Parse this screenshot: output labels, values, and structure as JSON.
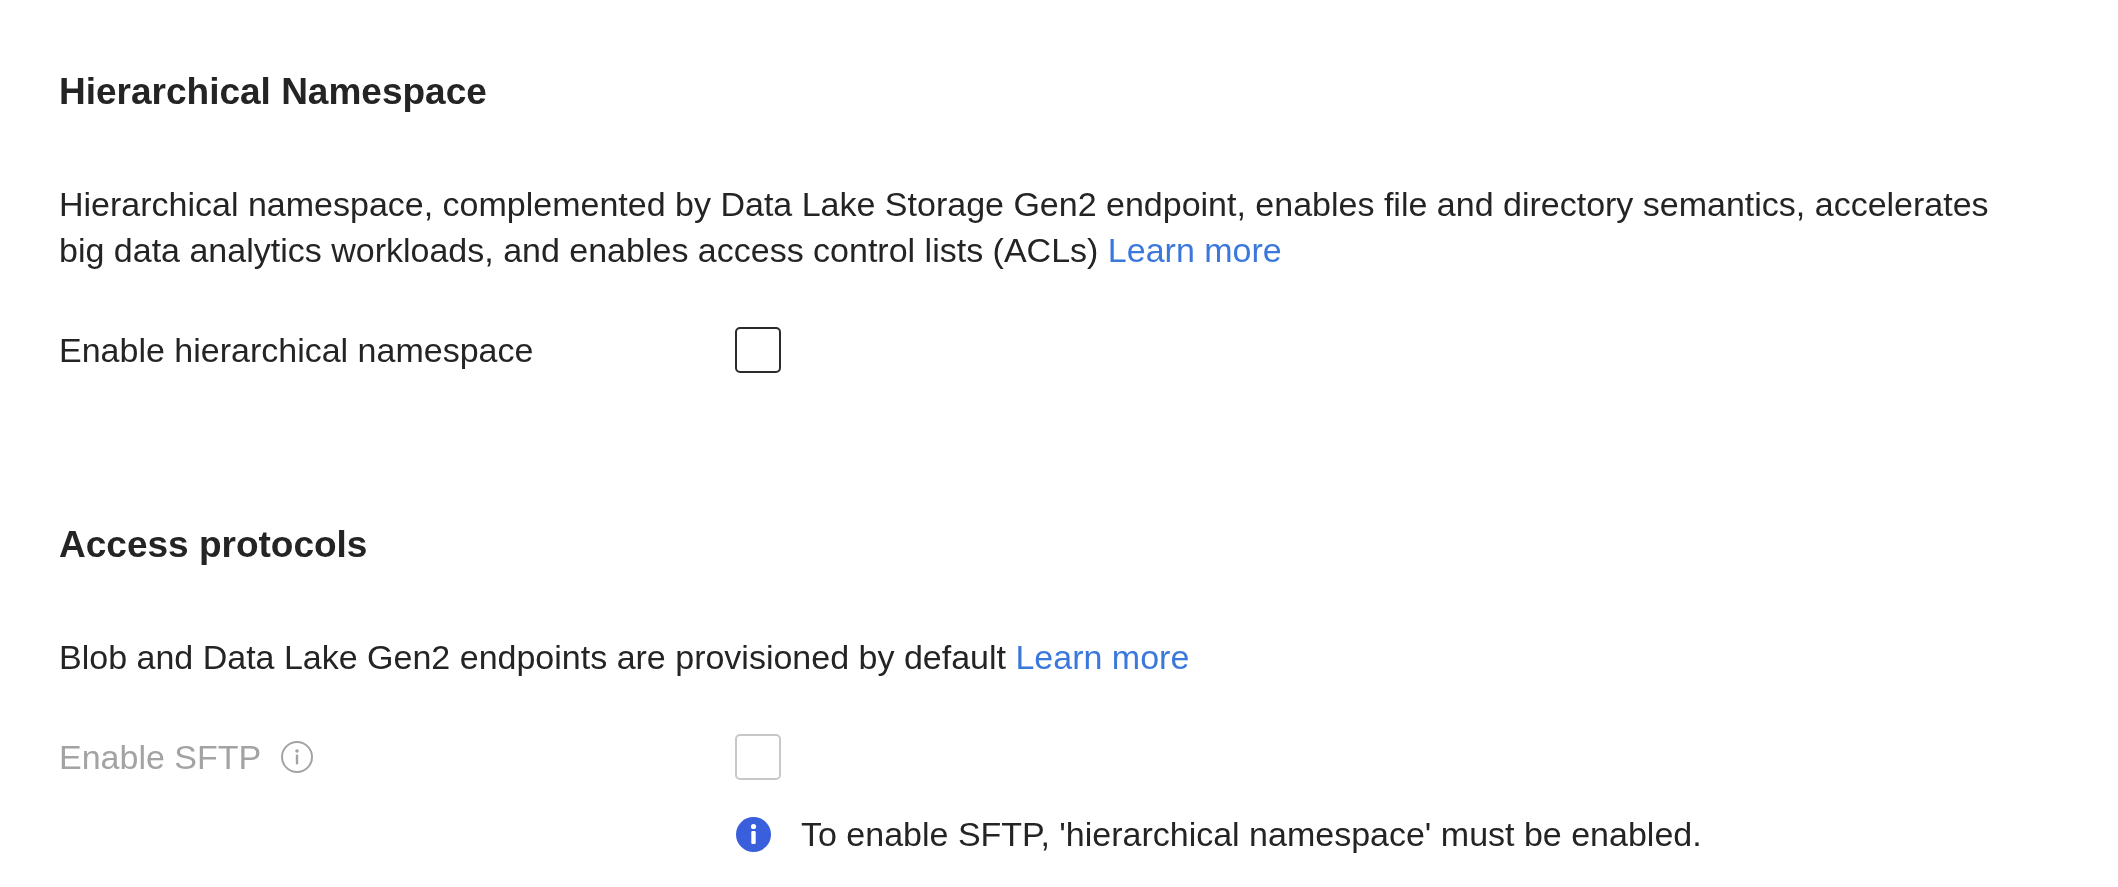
{
  "sections": [
    {
      "title": "Hierarchical Namespace",
      "description": "Hierarchical namespace, complemented by Data Lake Storage Gen2 endpoint, enables file and directory semantics, accelerates big data analytics workloads, and enables access control lists (ACLs)",
      "link": "Learn more",
      "fields": [
        {
          "label": "Enable hierarchical namespace",
          "info_icon": false,
          "checked": false,
          "disabled": false
        }
      ]
    },
    {
      "title": "Access protocols",
      "description": "Blob and Data Lake Gen2 endpoints are provisioned by default",
      "link": "Learn more",
      "fields": [
        {
          "label": "Enable SFTP",
          "info_icon": true,
          "checked": false,
          "disabled": true,
          "message": {
            "kind": "info",
            "text": "To enable SFTP, 'hierarchical namespace' must be enabled."
          }
        }
      ]
    }
  ]
}
